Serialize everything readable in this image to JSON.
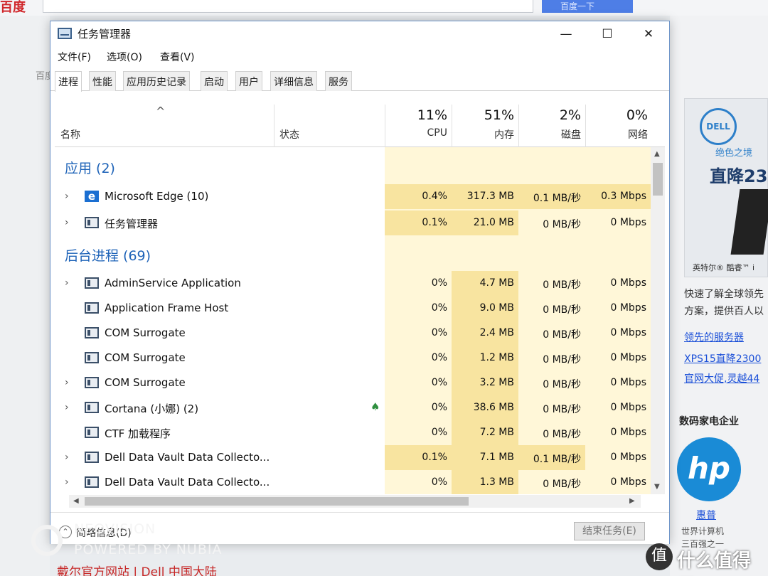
{
  "window": {
    "title": "任务管理器",
    "minimize": "—",
    "maximize": "☐",
    "close": "✕"
  },
  "menu": [
    "文件(F)",
    "选项(O)",
    "查看(V)"
  ],
  "tabs": [
    "进程",
    "性能",
    "应用历史记录",
    "启动",
    "用户",
    "详细信息",
    "服务"
  ],
  "active_tab": "进程",
  "columns": {
    "sort_arrow": "^",
    "name": "名称",
    "status": "状态",
    "cpu_pct": "11%",
    "cpu": "CPU",
    "mem_pct": "51%",
    "mem": "内存",
    "disk_pct": "2%",
    "disk": "磁盘",
    "net_pct": "0%",
    "net": "网络"
  },
  "groups": {
    "apps": "应用 (2)",
    "background": "后台进程 (69)"
  },
  "apps": [
    {
      "name": "Microsoft Edge (10)",
      "cpu": "0.4%",
      "mem": "317.3 MB",
      "disk": "0.1 MB/秒",
      "net": "0.3 Mbps"
    },
    {
      "name": "任务管理器",
      "cpu": "0.1%",
      "mem": "21.0 MB",
      "disk": "0 MB/秒",
      "net": "0 Mbps"
    }
  ],
  "background": [
    {
      "name": "AdminService Application",
      "cpu": "0%",
      "mem": "4.7 MB",
      "disk": "0 MB/秒",
      "net": "0 Mbps"
    },
    {
      "name": "Application Frame Host",
      "cpu": "0%",
      "mem": "9.0 MB",
      "disk": "0 MB/秒",
      "net": "0 Mbps"
    },
    {
      "name": "COM Surrogate",
      "cpu": "0%",
      "mem": "2.4 MB",
      "disk": "0 MB/秒",
      "net": "0 Mbps"
    },
    {
      "name": "COM Surrogate",
      "cpu": "0%",
      "mem": "1.2 MB",
      "disk": "0 MB/秒",
      "net": "0 Mbps"
    },
    {
      "name": "COM Surrogate",
      "cpu": "0%",
      "mem": "3.2 MB",
      "disk": "0 MB/秒",
      "net": "0 Mbps"
    },
    {
      "name": "Cortana (小娜) (2)",
      "cpu": "0%",
      "mem": "38.6 MB",
      "disk": "0 MB/秒",
      "net": "0 Mbps"
    },
    {
      "name": "CTF 加载程序",
      "cpu": "0%",
      "mem": "7.2 MB",
      "disk": "0 MB/秒",
      "net": "0 Mbps"
    },
    {
      "name": "Dell Data Vault Data Collecto...",
      "cpu": "0.1%",
      "mem": "7.1 MB",
      "disk": "0.1 MB/秒",
      "net": "0 Mbps"
    },
    {
      "name": "Dell Data Vault Data Collecto...",
      "cpu": "0%",
      "mem": "1.3 MB",
      "disk": "0 MB/秒",
      "net": "0 Mbps"
    }
  ],
  "footer": {
    "fewer_details": "简略信息(D)",
    "end_task": "结束任务(E)"
  },
  "background_page": {
    "logo": "百度",
    "search_btn": "百度一下",
    "left_text": "百度",
    "ad_tag": "绝色之境",
    "ad_big": "直降23",
    "ad_caption": "英特尔® 酷睿™ i",
    "desc_line1": "快速了解全球领先",
    "desc_line2": "方案，提供百人以",
    "links": [
      "领先的服务器",
      "XPS15直降2300",
      "官网大促,灵越44"
    ],
    "section": "数码家电企业",
    "hp_logo": "hp",
    "hp_name": "惠普",
    "hp_sub1": "世界计算机",
    "hp_sub2": "三百强之一",
    "bottom_link": "戴尔官方网站 | Dell 中国大陆",
    "dell_logo": "DELL"
  },
  "watermark": {
    "line1": "NEOVISION",
    "line2": "POWERED BY NUBIA",
    "site": "什么值得买",
    "badge": "值"
  },
  "colors": {
    "accent": "#1e63b8",
    "resource_bg": "#fff7d8",
    "resource_hot": "#f8e4a0"
  }
}
